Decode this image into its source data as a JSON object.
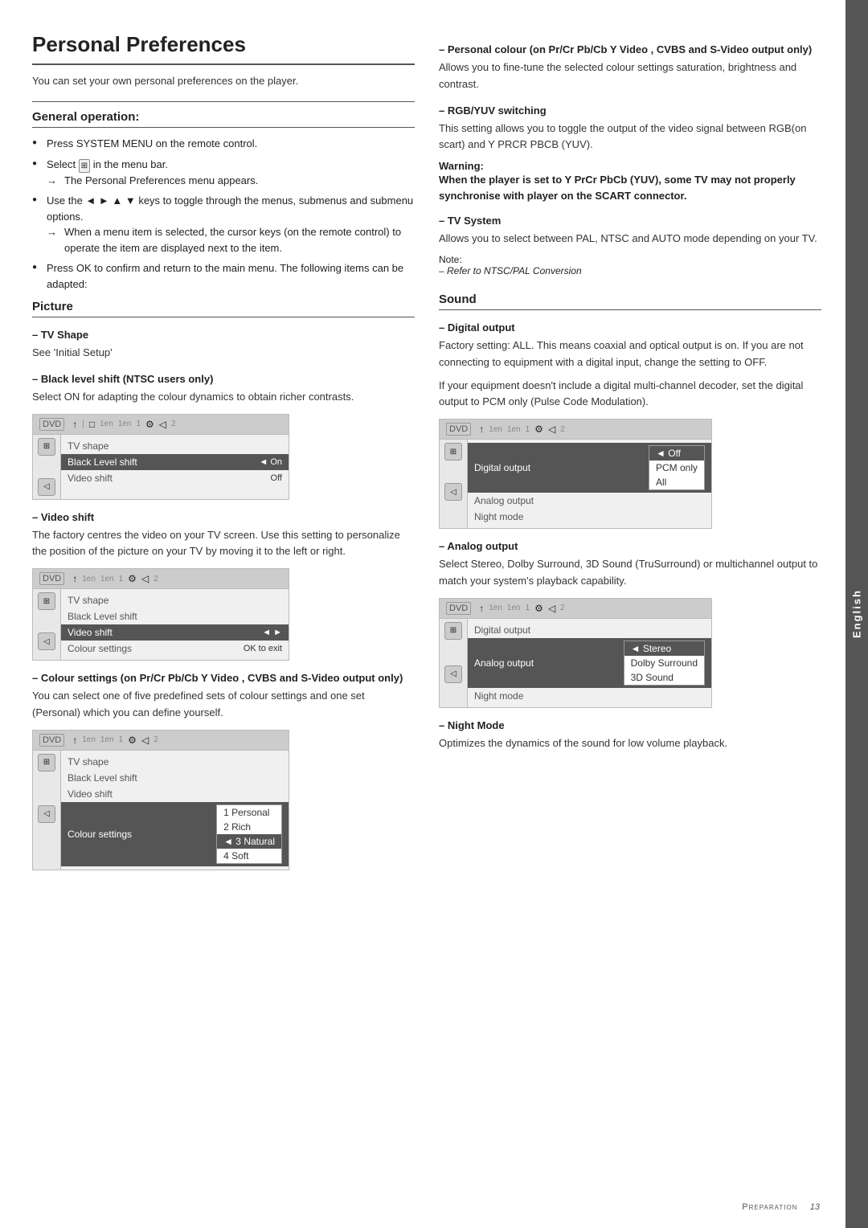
{
  "page": {
    "title": "Personal Preferences",
    "intro": "You can set your own personal preferences on the player.",
    "side_tab": "English"
  },
  "general_operation": {
    "title": "General operation:",
    "bullets": [
      "Press SYSTEM MENU on the remote control.",
      "Select  in the menu bar.",
      "The Personal Preferences menu appears.",
      "Use the ◄ ► ▲ ▼ keys to toggle through the menus, submenus and submenu options.",
      "When a menu item is selected, the cursor keys (on the remote control) to operate the item are displayed next to the item.",
      "Press OK to confirm and return to the main menu. The following items can be adapted:"
    ],
    "arrow_items": [
      "The Personal Preferences menu appears.",
      "When a menu item is selected, the cursor keys (on the remote control) to operate the item are displayed next to the item."
    ]
  },
  "picture": {
    "title": "Picture",
    "tv_shape": {
      "dash_title": "TV Shape",
      "body": "See 'Initial Setup'"
    },
    "black_level": {
      "dash_title": "Black level shift (NTSC users only)",
      "body": "Select ON for adapting the colour dynamics to obtain richer contrasts.",
      "menu": {
        "top_icons": [
          "↑",
          "□",
          "⚙",
          "◁"
        ],
        "top_labels": [
          "1en",
          "1en",
          "1",
          "2"
        ],
        "rows": [
          {
            "label": "TV shape",
            "value": "",
            "highlighted": false
          },
          {
            "label": "Black Level shift",
            "value": "◄ On",
            "highlighted": true
          },
          {
            "label": "Video shift",
            "value": "Off",
            "highlighted": false
          }
        ]
      }
    },
    "video_shift": {
      "dash_title": "Video shift",
      "body": "The factory centres the video on your TV screen. Use this setting to personalize the position of the picture on your TV by moving it to the left or right.",
      "menu": {
        "rows": [
          {
            "label": "TV shape",
            "value": "",
            "highlighted": false
          },
          {
            "label": "Black Level shift",
            "value": "",
            "highlighted": false
          },
          {
            "label": "Video shift",
            "value": "◄►",
            "highlighted": true
          },
          {
            "label": "Colour settings",
            "value": "OK to exit",
            "highlighted": false
          }
        ]
      }
    },
    "colour_settings": {
      "dash_title": "Colour settings  (on Pr/Cr Pb/Cb Y Video , CVBS and S-Video output only)",
      "body": "You can select one of five predefined sets of colour settings and one set (Personal) which you can define yourself.",
      "menu": {
        "rows": [
          {
            "label": "TV shape",
            "value": "",
            "highlighted": false
          },
          {
            "label": "Black Level shift",
            "value": "",
            "highlighted": false
          },
          {
            "label": "Video shift",
            "value": "",
            "highlighted": false
          },
          {
            "label": "Colour settings",
            "value": "",
            "highlighted": true
          }
        ],
        "dropdown": [
          "1 Personal",
          "2 Rich",
          "3 Natural",
          "4 Soft"
        ],
        "selected": "3 Natural"
      }
    },
    "personal_colour": {
      "dash_title": "Personal colour  (on Pr/Cr Pb/Cb Y Video , CVBS and S-Video output only)",
      "body": "Allows you to fine-tune the selected colour settings saturation, brightness and contrast."
    },
    "rgb_yuv": {
      "dash_title": "RGB/YUV switching",
      "body": "This setting allows you to toggle the output of the video signal between RGB(on scart) and Y PRCR PBCB (YUV).",
      "warning": {
        "label": "Warning:",
        "text": "When the player is set to Y PrCr PbCb (YUV), some TV may not properly synchronise with player on the SCART connector."
      }
    },
    "tv_system": {
      "dash_title": "TV System",
      "body": "Allows you to select between PAL, NTSC and AUTO mode depending on your TV.",
      "note": "– Refer to NTSC/PAL Conversion"
    }
  },
  "sound": {
    "title": "Sound",
    "digital_output": {
      "dash_title": "Digital output",
      "body1": "Factory setting: ALL. This means coaxial and optical output is on. If you are not connecting to equipment with a digital input, change the setting to OFF.",
      "body2": "If your equipment doesn't include a digital multi-channel decoder, set the digital output to PCM only (Pulse Code Modulation).",
      "menu": {
        "rows": [
          {
            "label": "Digital output",
            "value": "◄ Off",
            "highlighted": true
          },
          {
            "label": "Analog output",
            "value": "PCM only",
            "highlighted": false
          },
          {
            "label": "Night mode",
            "value": "All",
            "highlighted": false
          }
        ]
      }
    },
    "analog_output": {
      "dash_title": "Analog output",
      "body": "Select Stereo, Dolby Surround, 3D Sound (TruSurround) or multichannel output to match your system's playback capability.",
      "menu": {
        "rows": [
          {
            "label": "Digital output",
            "value": "",
            "highlighted": false
          },
          {
            "label": "Analog output",
            "value": "◄ Stereo",
            "highlighted": true
          },
          {
            "label": "Night mode",
            "value": "",
            "highlighted": false
          }
        ],
        "dropdown": [
          "Stereo",
          "Dolby Surround",
          "3D Sound"
        ],
        "selected": "Stereo"
      }
    },
    "night_mode": {
      "dash_title": "Night Mode",
      "body": "Optimizes the dynamics of the sound for low volume playback."
    }
  },
  "footer": {
    "prep_label": "Preparation",
    "page_num": "13"
  }
}
